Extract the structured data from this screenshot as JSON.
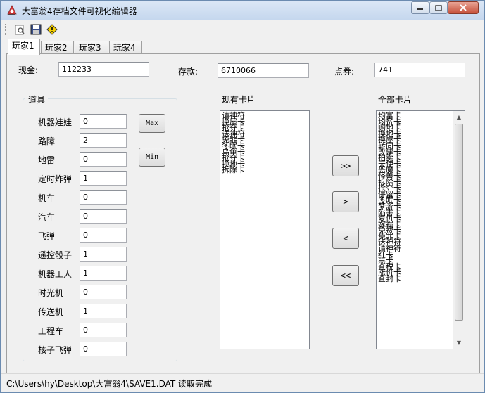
{
  "window": {
    "title": "大富翁4存档文件可视化编辑器"
  },
  "tabs": [
    "玩家1",
    "玩家2",
    "玩家3",
    "玩家4"
  ],
  "money": {
    "cash_label": "现金:",
    "cash_value": "112233",
    "deposit_label": "存款:",
    "deposit_value": "6710066",
    "points_label": "点券:",
    "points_value": "741"
  },
  "items": {
    "title": "道具",
    "rows": [
      {
        "label": "机器娃娃",
        "value": "0"
      },
      {
        "label": "路障",
        "value": "2"
      },
      {
        "label": "地雷",
        "value": "0"
      },
      {
        "label": "定时炸弹",
        "value": "1"
      },
      {
        "label": "机车",
        "value": "0"
      },
      {
        "label": "汽车",
        "value": "0"
      },
      {
        "label": "飞弹",
        "value": "0"
      },
      {
        "label": "遥控骰子",
        "value": "1"
      },
      {
        "label": "机器工人",
        "value": "1"
      },
      {
        "label": "时光机",
        "value": "0"
      },
      {
        "label": "传送机",
        "value": "1"
      },
      {
        "label": "工程车",
        "value": "0"
      },
      {
        "label": "核子飞弹",
        "value": "0"
      }
    ],
    "max_label": "Max",
    "min_label": "Min"
  },
  "owned_cards": {
    "title": "现有卡片",
    "items": [
      "请神符",
      "换屋卡",
      "抢夺卡",
      "送神符",
      "免罪卡",
      "冬眠卡",
      "乌龟卡",
      "抢夺卡",
      "换地卡",
      "拆除卡"
    ]
  },
  "transfer_buttons": [
    ">>",
    ">",
    "<",
    "<<"
  ],
  "all_cards": {
    "title": "全部卡片",
    "items": [
      "均富卡",
      "均贫卡",
      "购地卡",
      "换地卡",
      "换屋卡",
      "转向卡",
      "改建卡",
      "拍卖卡",
      "天使卡",
      "恶魔卡",
      "怪兽卡",
      "拆除卡",
      "抢夺卡",
      "停留卡",
      "冬眠卡",
      "梦游卡",
      "陷害卡",
      "复仇卡",
      "嫁祸卡",
      "免费卡",
      "免罪卡",
      "送神符",
      "请神符",
      "红卡",
      "黑卡",
      "查税卡",
      "涨价卡",
      "查封卡"
    ]
  },
  "status": {
    "text": "C:\\Users\\hy\\Desktop\\大富翁4\\SAVE1.DAT 读取完成"
  }
}
